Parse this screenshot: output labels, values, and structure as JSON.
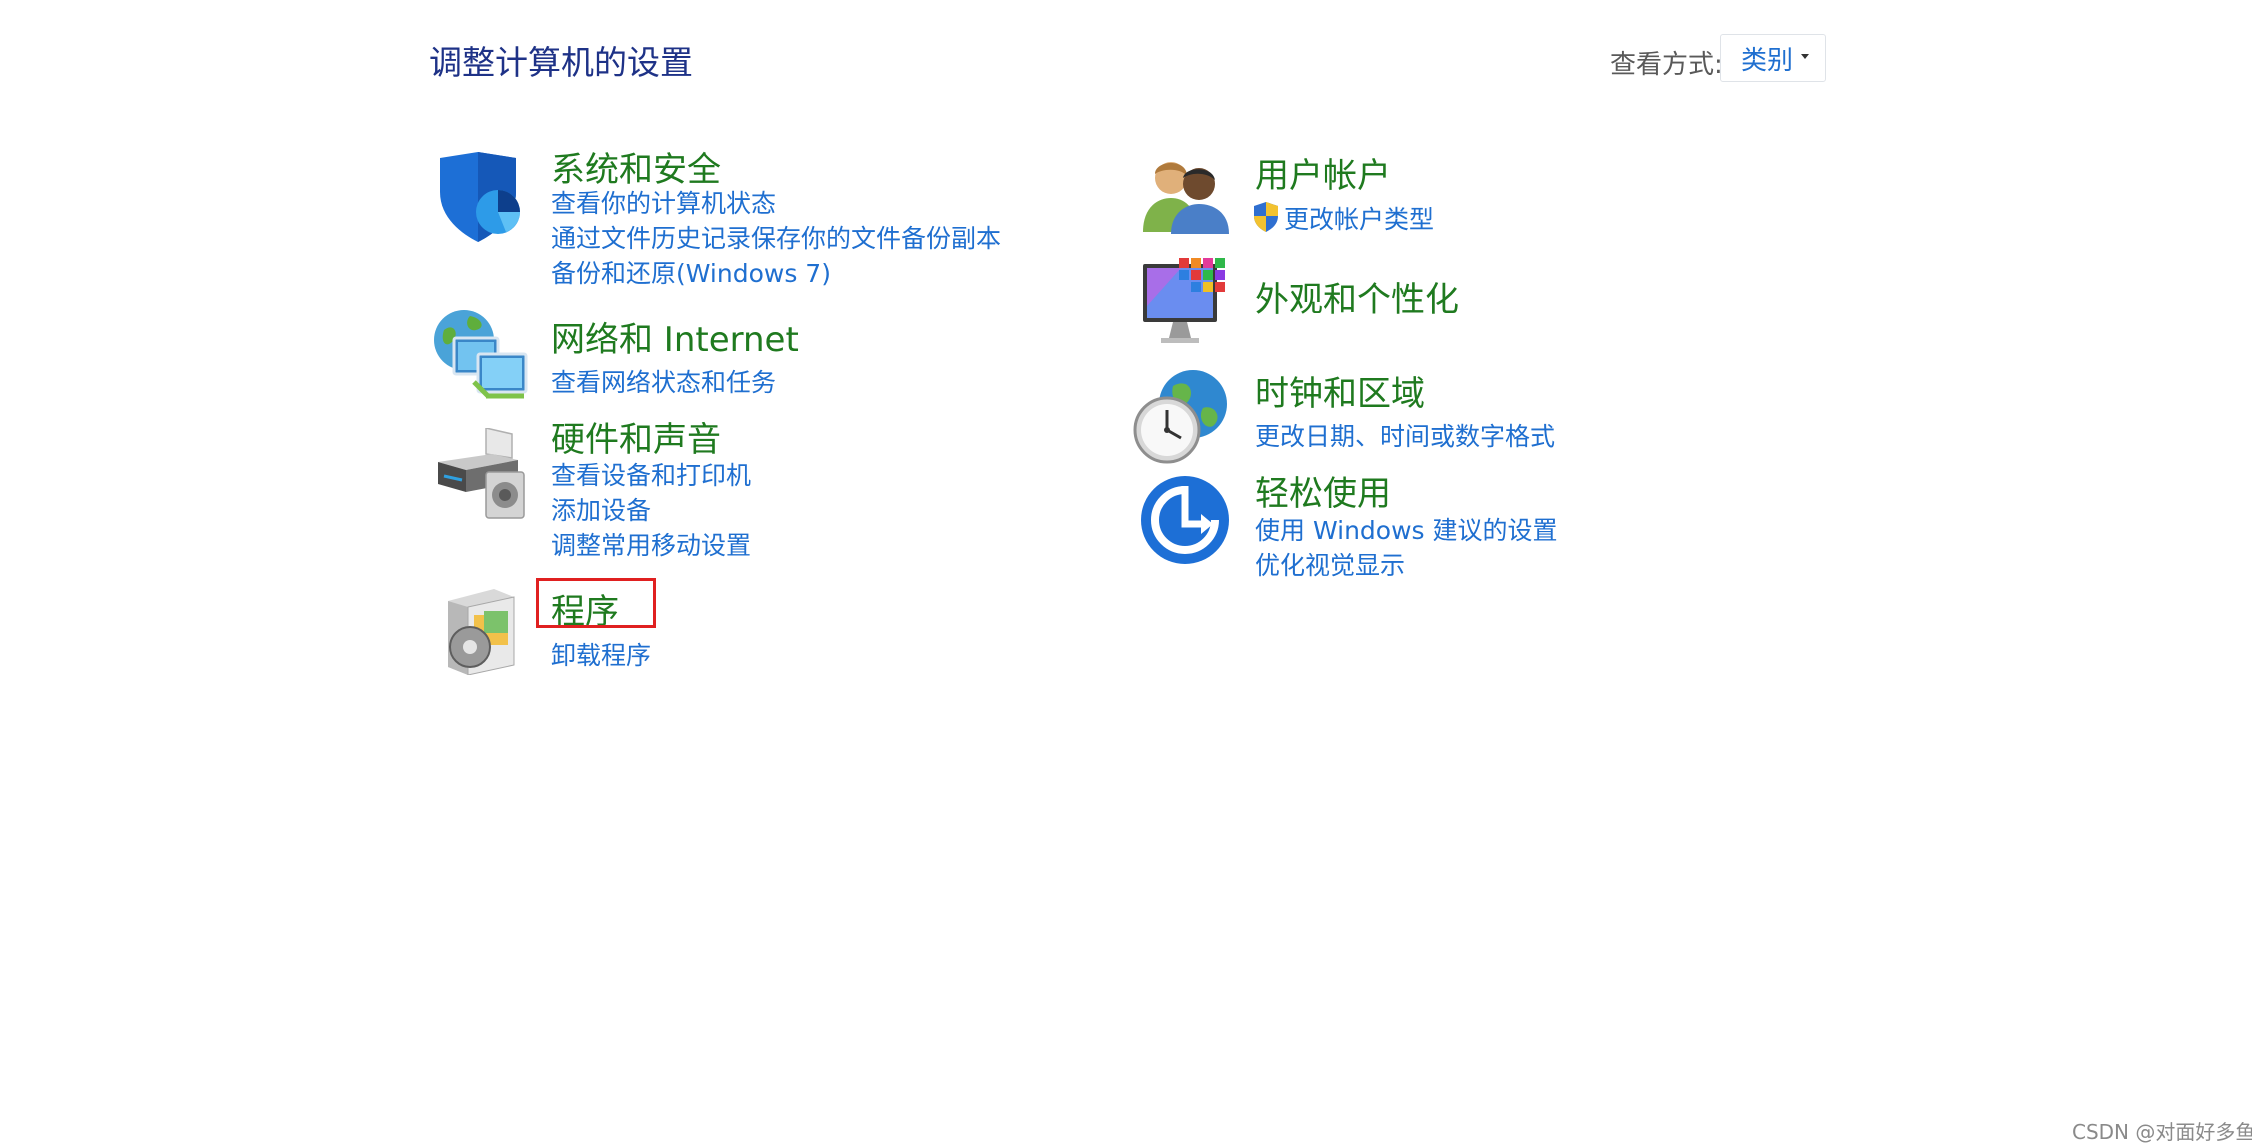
{
  "header": {
    "title": "调整计算机的设置",
    "view_label": "查看方式:",
    "view_value": "类别"
  },
  "categories": {
    "system": {
      "title": "系统和安全",
      "links": [
        "查看你的计算机状态",
        "通过文件历史记录保存你的文件备份副本",
        "备份和还原(Windows 7)"
      ],
      "icon": "shield-icon"
    },
    "network": {
      "title": "网络和 Internet",
      "links": [
        "查看网络状态和任务"
      ],
      "icon": "network-globe-icon"
    },
    "hardware": {
      "title": "硬件和声音",
      "links": [
        "查看设备和打印机",
        "添加设备",
        "调整常用移动设置"
      ],
      "icon": "printer-icon"
    },
    "programs": {
      "title": "程序",
      "links": [
        "卸载程序"
      ],
      "icon": "programs-disc-icon"
    },
    "users": {
      "title": "用户帐户",
      "links": [
        "更改帐户类型"
      ],
      "icon": "users-icon"
    },
    "appearance": {
      "title": "外观和个性化",
      "links": [],
      "icon": "monitor-tiles-icon"
    },
    "clock": {
      "title": "时钟和区域",
      "links": [
        "更改日期、时间或数字格式"
      ],
      "icon": "clock-globe-icon"
    },
    "ease": {
      "title": "轻松使用",
      "links": [
        "使用 Windows 建议的设置",
        "优化视觉显示"
      ],
      "icon": "ease-of-access-icon"
    }
  },
  "watermark": "CSDN @对面好多鱼",
  "colors": {
    "title_blue": "#1e3287",
    "category_green": "#1f7a1f",
    "link_blue": "#1f6fd0",
    "highlight_red": "#e02020"
  }
}
